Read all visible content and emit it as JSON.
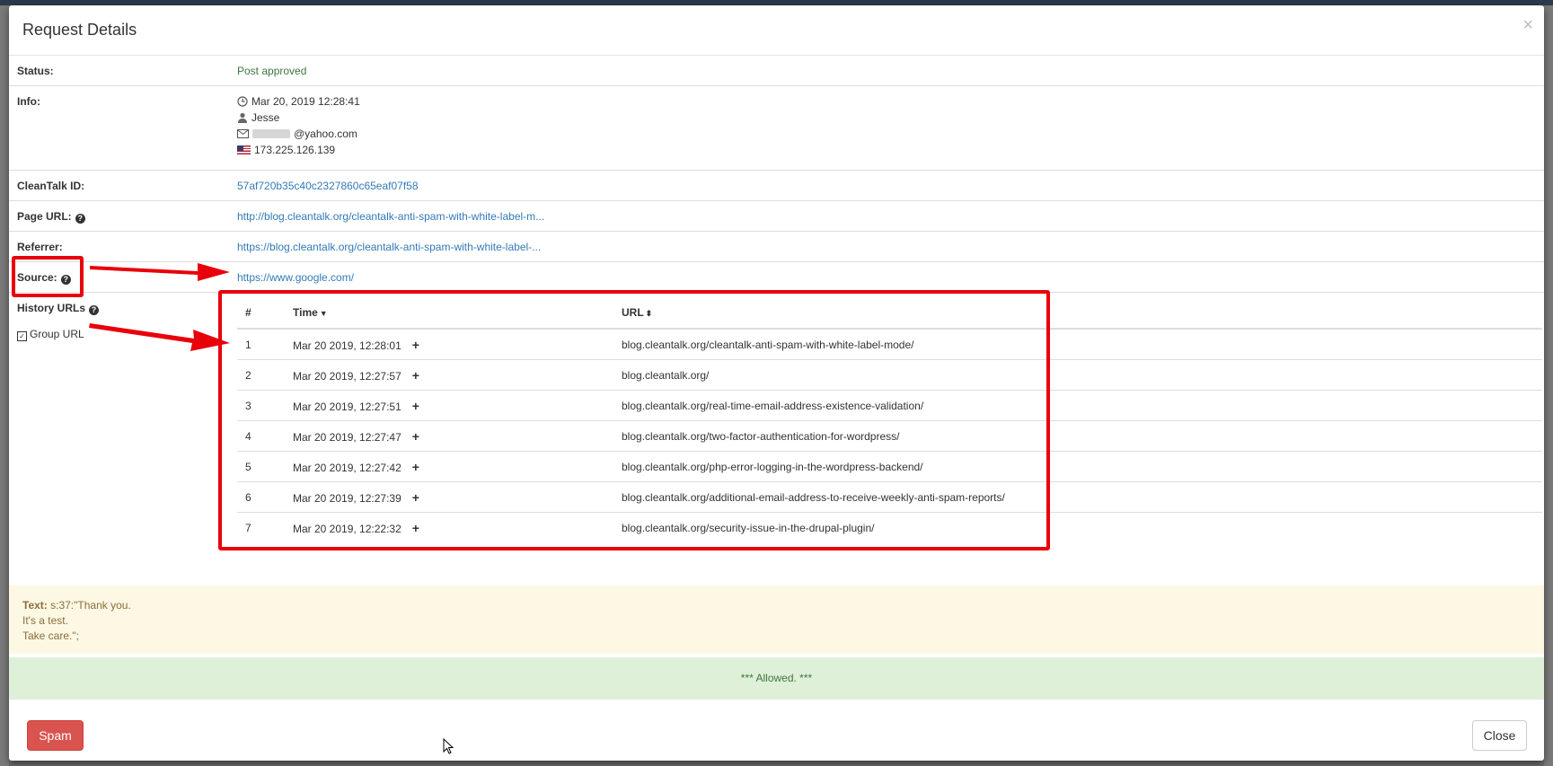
{
  "modal": {
    "title": "Request Details",
    "close_symbol": "×"
  },
  "status": {
    "label": "Status:",
    "value": "Post approved"
  },
  "info": {
    "label": "Info:",
    "datetime": "Mar 20, 2019 12:28:41",
    "name": "Jesse",
    "email_suffix": "@yahoo.com",
    "ip": "173.225.126.139"
  },
  "cleantalk_id": {
    "label": "CleanTalk ID:",
    "value": "57af720b35c40c2327860c65eaf07f58"
  },
  "page_url": {
    "label": "Page URL:",
    "value": "http://blog.cleantalk.org/cleantalk-anti-spam-with-white-label-m..."
  },
  "referrer": {
    "label": "Referrer:",
    "value": "https://blog.cleantalk.org/cleantalk-anti-spam-with-white-label-..."
  },
  "source": {
    "label": "Source:",
    "value": "https://www.google.com/"
  },
  "history": {
    "label": "History URLs",
    "group_label": "Group URL",
    "columns": {
      "num": "#",
      "time": "Time",
      "url": "URL"
    },
    "rows": [
      {
        "num": "1",
        "time": "Mar 20 2019, 12:28:01",
        "url": "blog.cleantalk.org/cleantalk-anti-spam-with-white-label-mode/"
      },
      {
        "num": "2",
        "time": "Mar 20 2019, 12:27:57",
        "url": "blog.cleantalk.org/"
      },
      {
        "num": "3",
        "time": "Mar 20 2019, 12:27:51",
        "url": "blog.cleantalk.org/real-time-email-address-existence-validation/"
      },
      {
        "num": "4",
        "time": "Mar 20 2019, 12:27:47",
        "url": "blog.cleantalk.org/two-factor-authentication-for-wordpress/"
      },
      {
        "num": "5",
        "time": "Mar 20 2019, 12:27:42",
        "url": "blog.cleantalk.org/php-error-logging-in-the-wordpress-backend/"
      },
      {
        "num": "6",
        "time": "Mar 20 2019, 12:27:39",
        "url": "blog.cleantalk.org/additional-email-address-to-receive-weekly-anti-spam-reports/"
      },
      {
        "num": "7",
        "time": "Mar 20 2019, 12:22:32",
        "url": "blog.cleantalk.org/security-issue-in-the-drupal-plugin/"
      }
    ]
  },
  "text_panel": {
    "label": "Text:",
    "line1": "s:37:\"Thank you.",
    "line2": "It's a test.",
    "line3": "Take care.\";"
  },
  "result": "*** Allowed. ***",
  "footer": {
    "spam_label": "Spam",
    "close_label": "Close"
  },
  "icons": [
    "clock-icon",
    "user-icon",
    "envelope-icon",
    "us-flag-icon",
    "question-circle-icon",
    "sort-icon",
    "plus-icon",
    "checkbox-icon"
  ],
  "colors": {
    "annotation_red": "#e8000b",
    "link": "#337ab7",
    "success": "#3c763d",
    "danger": "#d9534f"
  }
}
